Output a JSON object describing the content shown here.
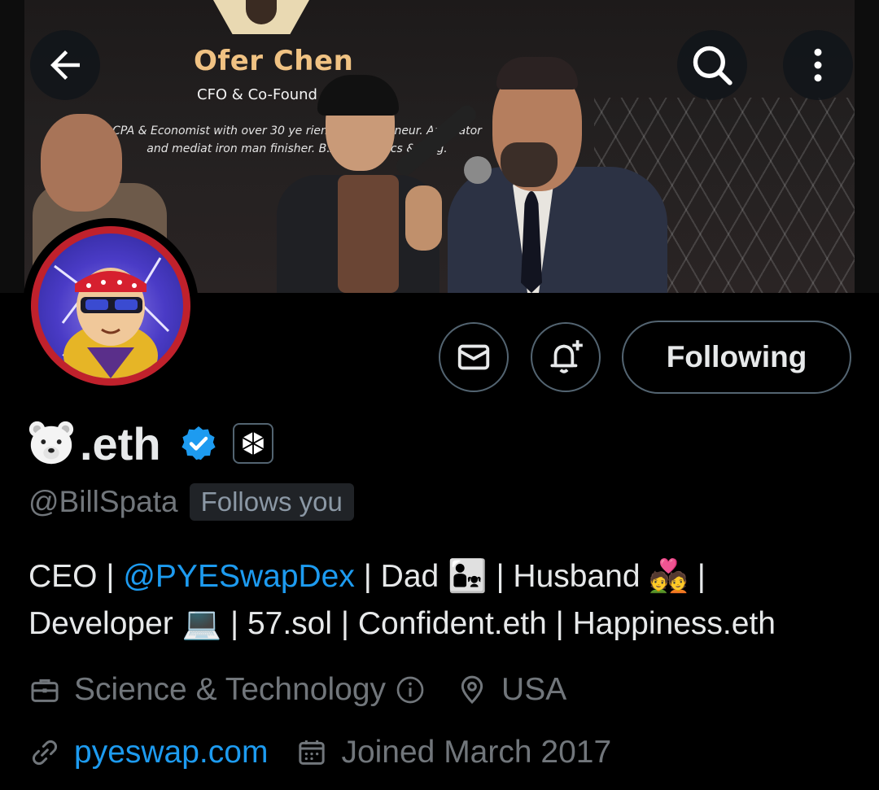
{
  "banner": {
    "poster_title": "Ofer Chen",
    "poster_subtitle": "CFO & Co-Found",
    "poster_body": "CPA & Economist with over 30 ye                rience Entrepreneur. Arbitrator and mediat                iron man finisher. B.A Economics & Ac                g."
  },
  "profile": {
    "display_name_suffix": ".eth",
    "handle": "@BillSpata",
    "follows_you": "Follows you",
    "following_label": "Following",
    "bio_parts": {
      "p1": "CEO | ",
      "mention": "@PYESwapDex",
      "p2": " | Dad 👨‍👧 | Husband 💑 |",
      "p3": "Developer 💻 | 57.sol | Confident.eth | Happiness.eth"
    },
    "category": "Science & Technology",
    "location": "USA",
    "website": "pyeswap.com",
    "joined": "Joined March 2017"
  },
  "colors": {
    "accent": "#1d9bf0",
    "muted": "#71767b",
    "border": "#536471"
  },
  "icons": [
    "back-arrow-icon",
    "search-icon",
    "more-vertical-icon",
    "mail-icon",
    "bell-plus-icon",
    "verified-badge-icon",
    "affiliate-badge-icon",
    "briefcase-icon",
    "info-icon",
    "location-pin-icon",
    "link-icon",
    "calendar-icon",
    "polar-bear-emoji"
  ]
}
